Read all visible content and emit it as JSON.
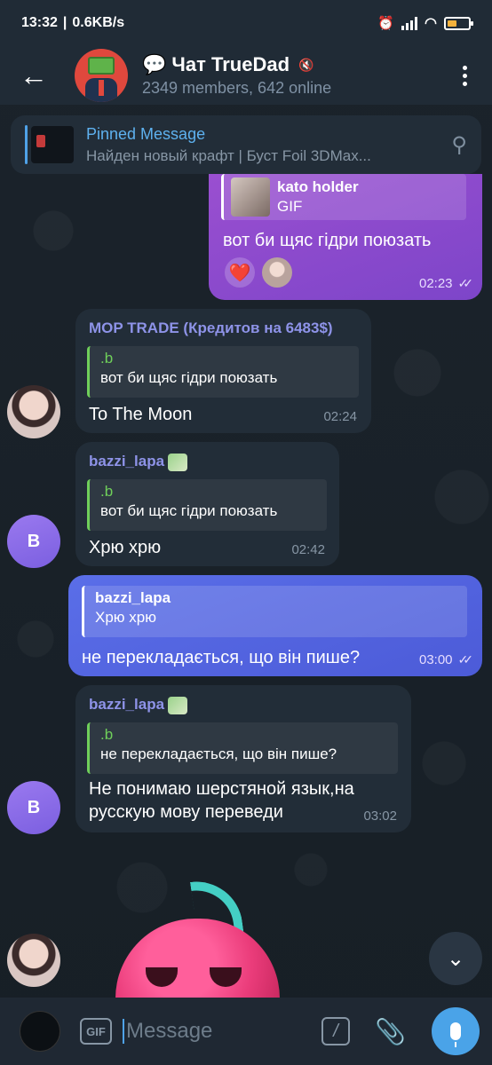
{
  "status_bar": {
    "time": "13:32",
    "net_speed": "0.6KB/s"
  },
  "header": {
    "back_icon": "arrow-left-icon",
    "chat_emoji": "💬",
    "title": "Чат TrueDad",
    "members": "2349 members, 642 online"
  },
  "pinned": {
    "label": "Pinned Message",
    "text": "Найден новый крафт | Буст Foil 3DMax..."
  },
  "messages": [
    {
      "reply_name": "kato holder",
      "reply_text": "GIF",
      "text": "вот би щяс гідри поюзать",
      "reactions": [
        "❤️",
        "avatar"
      ],
      "time": "02:23"
    },
    {
      "sender": "MOP TRADE (Кредитов на 6483$)",
      "reply_name": ".b",
      "reply_text": "вот би щяс гідри поюзать",
      "text": "To The Moon",
      "time": "02:24"
    },
    {
      "sender": "bazzi_lapa",
      "reply_name": ".b",
      "reply_text": "вот би щяс гідри поюзать",
      "text": "Хрю хрю",
      "time": "02:42",
      "avatar_letter": "B"
    },
    {
      "reply_name": "bazzi_lapa",
      "reply_text": "Хрю хрю",
      "text": "не перекладається, що він пише?",
      "time": "03:00"
    },
    {
      "sender": "bazzi_lapa",
      "reply_name": ".b",
      "reply_text": "не перекладається, що він пише?",
      "text": "Не понимаю шерстяной язык,на русскую мову переведи",
      "time": "03:02",
      "avatar_letter": "B"
    }
  ],
  "input": {
    "placeholder": "Message",
    "gif_label": "GIF",
    "command_label": "/"
  },
  "colors": {
    "accent": "#4aa3e8",
    "outgoing_purple": "#8a4acd",
    "outgoing_blue": "#5565e0",
    "incoming": "#222d38",
    "reply_green": "#6fcf5a",
    "sender_name": "#8e93e8"
  }
}
